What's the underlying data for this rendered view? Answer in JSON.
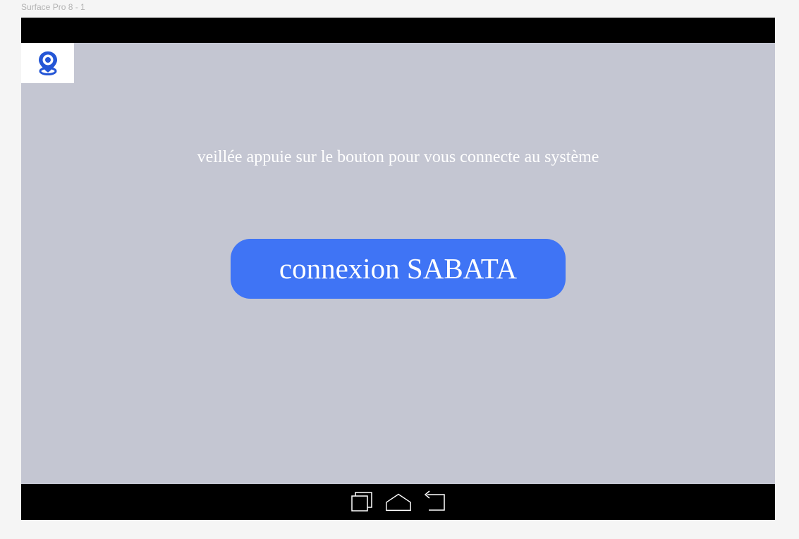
{
  "frame": {
    "label": "Surface Pro 8 - 1"
  },
  "header": {
    "logo_icon": "map-pin-icon",
    "logo_color": "#2456d6"
  },
  "main": {
    "instruction": "veillée appuie sur le bouton pour vous connecte au système",
    "connect_button_label": "connexion SABATA",
    "background_color": "#c4c6d2",
    "button_color": "#3f74f5"
  },
  "nav_bar": {
    "buttons": [
      {
        "icon": "recent-apps-icon"
      },
      {
        "icon": "home-icon"
      },
      {
        "icon": "back-icon"
      }
    ]
  }
}
